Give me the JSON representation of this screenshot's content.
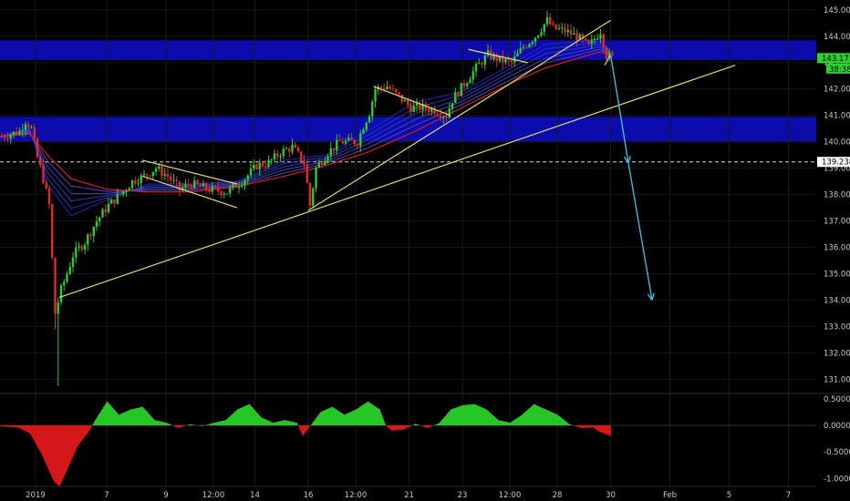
{
  "chart_data": [
    {
      "type": "candlestick",
      "panel": "price",
      "ylim": [
        130.6,
        145.2
      ],
      "yticks": [
        "131.000",
        "132.000",
        "133.000",
        "134.000",
        "135.000",
        "136.000",
        "137.000",
        "138.000",
        "139.000",
        "140.000",
        "141.000",
        "142.000",
        "143.000",
        "144.000",
        "145.000"
      ],
      "x_labels": [
        "2019",
        "7",
        "9",
        "12:00",
        "14",
        "16",
        "12:00",
        "21",
        "23",
        "12:00",
        "28",
        "30",
        "Feb",
        "5",
        "7"
      ],
      "x_label_index": [
        6,
        18,
        28,
        36,
        43,
        52,
        60,
        69,
        78,
        86,
        94,
        103,
        113,
        123,
        133
      ],
      "last_price_label": "143.171",
      "countdown_label": "38:38",
      "dashed_level_label": "139.238",
      "dashed_level": 139.238,
      "resistance_zones": [
        [
          143.1,
          143.85
        ],
        [
          140.0,
          140.95
        ]
      ],
      "series_path": [
        [
          0,
          140.2
        ],
        [
          3,
          140.4
        ],
        [
          4,
          140.8
        ],
        [
          5,
          140.5
        ],
        [
          6,
          139.4
        ],
        [
          7,
          138.6
        ],
        [
          8,
          137.6
        ],
        [
          9,
          133.5
        ],
        [
          10,
          134.4
        ],
        [
          11,
          135.0
        ],
        [
          12,
          135.7
        ],
        [
          14,
          136.2
        ],
        [
          16,
          137.0
        ],
        [
          18,
          137.6
        ],
        [
          20,
          138.0
        ],
        [
          22,
          138.5
        ],
        [
          24,
          138.7
        ],
        [
          26,
          139.0
        ],
        [
          28,
          138.7
        ],
        [
          30,
          138.2
        ],
        [
          32,
          138.4
        ],
        [
          35,
          138.2
        ],
        [
          38,
          138.1
        ],
        [
          41,
          138.6
        ],
        [
          43,
          139.1
        ],
        [
          45,
          139.2
        ],
        [
          47,
          139.6
        ],
        [
          49,
          139.8
        ],
        [
          51,
          139.2
        ],
        [
          52,
          137.6
        ],
        [
          53,
          139.0
        ],
        [
          55,
          139.6
        ],
        [
          57,
          140.0
        ],
        [
          60,
          140.0
        ],
        [
          61,
          140.6
        ],
        [
          62,
          141.1
        ],
        [
          63,
          142.0
        ],
        [
          65,
          142.1
        ],
        [
          67,
          141.7
        ],
        [
          69,
          141.3
        ],
        [
          71,
          141.3
        ],
        [
          73,
          141.2
        ],
        [
          75,
          141.0
        ],
        [
          76,
          141.6
        ],
        [
          78,
          142.2
        ],
        [
          80,
          142.8
        ],
        [
          82,
          143.3
        ],
        [
          84,
          143.1
        ],
        [
          86,
          143.0
        ],
        [
          88,
          143.6
        ],
        [
          90,
          144.0
        ],
        [
          92,
          144.6
        ],
        [
          93,
          144.3
        ],
        [
          95,
          144.2
        ],
        [
          97,
          144.0
        ],
        [
          99,
          143.6
        ],
        [
          100,
          143.9
        ],
        [
          101,
          144.2
        ],
        [
          102,
          143.3
        ],
        [
          103,
          143.2
        ]
      ],
      "ema_red": [
        [
          0,
          140.2
        ],
        [
          5,
          140.3
        ],
        [
          8,
          139.5
        ],
        [
          12,
          138.6
        ],
        [
          18,
          138.2
        ],
        [
          25,
          138.1
        ],
        [
          32,
          138.1
        ],
        [
          40,
          138.3
        ],
        [
          48,
          138.7
        ],
        [
          55,
          139.1
        ],
        [
          62,
          139.6
        ],
        [
          70,
          140.4
        ],
        [
          78,
          141.3
        ],
        [
          86,
          142.2
        ],
        [
          92,
          142.8
        ],
        [
          98,
          143.2
        ],
        [
          101,
          143.4
        ],
        [
          103,
          143.3
        ]
      ],
      "ema_blue_fast": [
        [
          0,
          140.2
        ],
        [
          5,
          140.5
        ],
        [
          8,
          138.4
        ],
        [
          12,
          137.2
        ],
        [
          18,
          137.8
        ],
        [
          25,
          138.4
        ],
        [
          32,
          138.4
        ],
        [
          40,
          138.5
        ],
        [
          48,
          139.3
        ],
        [
          55,
          139.5
        ],
        [
          62,
          140.4
        ],
        [
          70,
          141.5
        ],
        [
          78,
          141.9
        ],
        [
          86,
          142.9
        ],
        [
          92,
          143.7
        ],
        [
          98,
          143.8
        ],
        [
          101,
          143.9
        ],
        [
          103,
          143.4
        ]
      ],
      "trendlines": [
        [
          [
            10,
            134.1
          ],
          [
            124,
            142.9
          ]
        ],
        [
          [
            52,
            137.4
          ],
          [
            103,
            144.6
          ]
        ],
        [
          [
            24,
            139.3
          ],
          [
            40,
            138.4
          ]
        ],
        [
          [
            24,
            138.7
          ],
          [
            40,
            137.5
          ]
        ],
        [
          [
            63,
            142.1
          ],
          [
            76,
            141.0
          ]
        ],
        [
          [
            79,
            143.5
          ],
          [
            89,
            143.0
          ]
        ],
        [
          [
            102,
            142.9
          ],
          [
            103,
            143.3
          ]
        ]
      ],
      "projection": [
        [
          103,
          143.3
        ],
        [
          106,
          139.2
        ],
        [
          110,
          134.0
        ]
      ]
    },
    {
      "type": "histogram",
      "panel": "oscillator",
      "ylim": [
        -1.15,
        0.6
      ],
      "yticks": [
        "0.5000",
        "0.0000",
        "-0.5000",
        "-1.0000"
      ],
      "knots": [
        [
          0,
          -0.02
        ],
        [
          3,
          -0.04
        ],
        [
          5,
          -0.15
        ],
        [
          7,
          -0.55
        ],
        [
          9,
          -1.05
        ],
        [
          10,
          -1.15
        ],
        [
          11,
          -0.9
        ],
        [
          13,
          -0.4
        ],
        [
          15,
          -0.1
        ],
        [
          16,
          0.1
        ],
        [
          18,
          0.45
        ],
        [
          20,
          0.2
        ],
        [
          22,
          0.3
        ],
        [
          24,
          0.35
        ],
        [
          26,
          0.1
        ],
        [
          28,
          0.05
        ],
        [
          30,
          -0.05
        ],
        [
          32,
          0.02
        ],
        [
          34,
          -0.02
        ],
        [
          36,
          0.05
        ],
        [
          38,
          0.1
        ],
        [
          40,
          0.3
        ],
        [
          42,
          0.4
        ],
        [
          44,
          0.15
        ],
        [
          46,
          0.05
        ],
        [
          48,
          0.1
        ],
        [
          50,
          0.05
        ],
        [
          51,
          -0.2
        ],
        [
          52,
          -0.05
        ],
        [
          54,
          0.25
        ],
        [
          56,
          0.35
        ],
        [
          58,
          0.2
        ],
        [
          60,
          0.3
        ],
        [
          62,
          0.45
        ],
        [
          64,
          0.3
        ],
        [
          65,
          0.0
        ],
        [
          66,
          -0.1
        ],
        [
          68,
          -0.08
        ],
        [
          70,
          0.03
        ],
        [
          72,
          -0.05
        ],
        [
          74,
          0.04
        ],
        [
          76,
          0.3
        ],
        [
          78,
          0.38
        ],
        [
          80,
          0.4
        ],
        [
          82,
          0.3
        ],
        [
          84,
          0.1
        ],
        [
          86,
          0.05
        ],
        [
          88,
          0.2
        ],
        [
          90,
          0.4
        ],
        [
          92,
          0.3
        ],
        [
          94,
          0.2
        ],
        [
          96,
          0.02
        ],
        [
          98,
          -0.05
        ],
        [
          100,
          -0.04
        ],
        [
          101,
          -0.12
        ],
        [
          103,
          -0.2
        ]
      ]
    }
  ],
  "colors": {
    "background": "#000000",
    "up_candle": "#31c831",
    "down_candle": "#e02b2b",
    "zone": "#0d0db5",
    "trendline": "#e0dc68",
    "projection": "#45b8d6",
    "ema": "#d61e1e",
    "histogram_up": "#27c627",
    "histogram_down": "#d41818",
    "last_price_badge": "#2cd22c"
  }
}
